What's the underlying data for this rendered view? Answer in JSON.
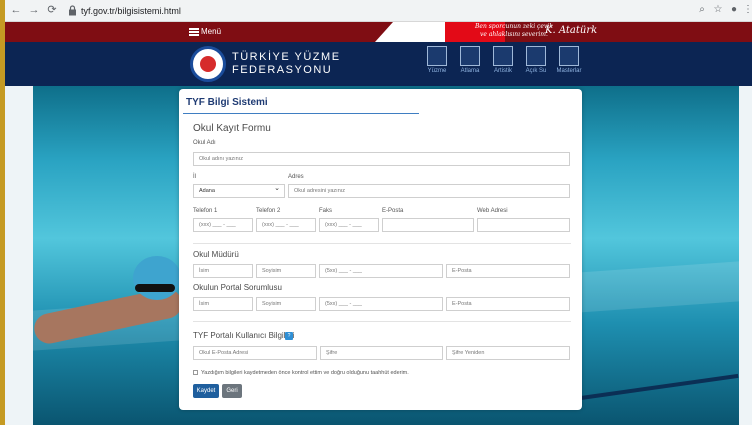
{
  "browser": {
    "url": "tyf.gov.tr/bilgisistemi.html"
  },
  "topbar": {
    "menu_label": "Menü",
    "quote_line1": "Ben sporcunun zeki çevik",
    "quote_line2": "ve ahlaklısını severim.",
    "signature": "K. Atatürk"
  },
  "header": {
    "brand_line1": "TÜRKİYE YÜZME",
    "brand_line2": "FEDERASYONU",
    "nav": [
      "Yüzme",
      "Atlama",
      "Artistik",
      "Açık Su",
      "Masterlar"
    ]
  },
  "card": {
    "title": "TYF Bilgi Sistemi",
    "form_title": "Okul Kayıt Formu",
    "okul_adi": {
      "label": "Okul Adı",
      "placeholder": "Okul adını yazınız"
    },
    "il": {
      "label": "İl",
      "value": "Adana"
    },
    "adres": {
      "label": "Adres",
      "placeholder": "Okul adresini yazınız"
    },
    "telefon1": {
      "label": "Telefon 1",
      "placeholder": "(xxx) ___ - ___"
    },
    "telefon2": {
      "label": "Telefon 2",
      "placeholder": "(xxx) ___ - ___"
    },
    "faks": {
      "label": "Faks",
      "placeholder": "(xxx) ___ - ___"
    },
    "eposta": {
      "label": "E-Posta"
    },
    "web": {
      "label": "Web Adresi"
    },
    "mudur": {
      "title": "Okul Müdürü",
      "isim": "İsim",
      "soyisim": "Soyisim",
      "gsm": "(5xx) ___ - ___",
      "eposta": "E-Posta"
    },
    "portal": {
      "title": "Okulun Portal Sorumlusu",
      "isim": "İsim",
      "soyisim": "Soyisim",
      "gsm": "(5xx) ___ - ___",
      "eposta": "E-Posta"
    },
    "kullanici": {
      "title": "TYF Portalı Kullanıcı Bilgileri",
      "help": "?",
      "eposta": "Okul E-Posta Adresi",
      "sifre": "Şifre",
      "sifre_tekrar": "Şifre Yeniden"
    },
    "consent": "Yazdığım bilgileri kaydetmeden önce kontrol ettim ve doğru olduğunu taahhüt ederim.",
    "buttons": {
      "save": "Kaydet",
      "back": "Geri"
    }
  },
  "colors": {
    "topbar": "#7f0d13",
    "header": "#0c2553",
    "title": "#1f3b73",
    "save_button": "#1f5f9e",
    "back_button": "#6c757d"
  }
}
